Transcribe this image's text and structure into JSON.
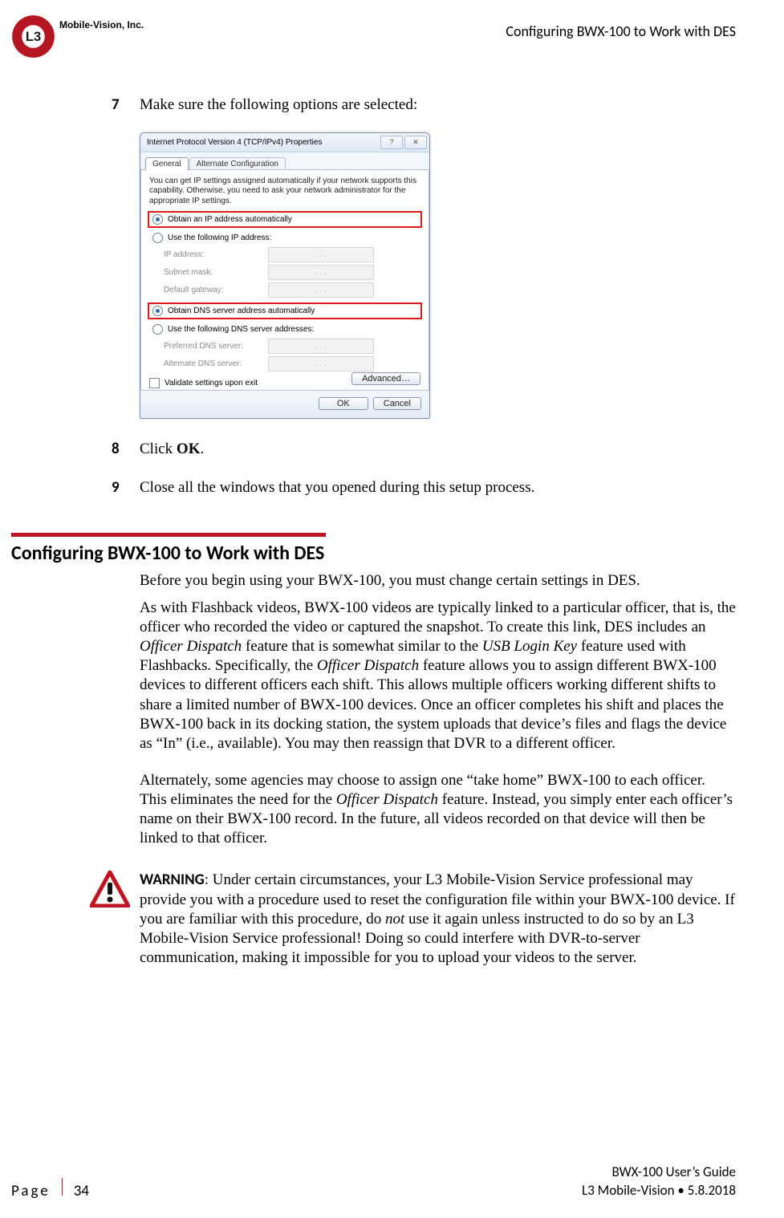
{
  "header": {
    "company": "Mobile-Vision, Inc.",
    "doc_section": "Configuring BWX-100 to Work with DES"
  },
  "steps": {
    "s7": {
      "num": "7",
      "text": "Make sure the following options are selected:"
    },
    "s8": {
      "num": "8",
      "text_pre": "Click ",
      "text_bold": "OK",
      "text_post": "."
    },
    "s9": {
      "num": "9",
      "text": "Close all the windows that you opened during this setup process."
    }
  },
  "dialog": {
    "title": "Internet Protocol Version 4 (TCP/IPv4) Properties",
    "help_glyph": "?",
    "close_glyph": "✕",
    "tabs": {
      "general": "General",
      "alt": "Alternate Configuration"
    },
    "desc": "You can get IP settings assigned automatically if your network supports this capability. Otherwise, you need to ask your network administrator for the appropriate IP settings.",
    "r_obtain_ip": "Obtain an IP address automatically",
    "r_use_ip": "Use the following IP address:",
    "f_ip": "IP address:",
    "f_subnet": "Subnet mask:",
    "f_gateway": "Default gateway:",
    "r_obtain_dns": "Obtain DNS server address automatically",
    "r_use_dns": "Use the following DNS server addresses:",
    "f_dns1": "Preferred DNS server:",
    "f_dns2": "Alternate DNS server:",
    "placeholder": ".       .       .",
    "chk_validate": "Validate settings upon exit",
    "btn_adv": "Advanced…",
    "btn_ok": "OK",
    "btn_cancel": "Cancel"
  },
  "section": {
    "title": "Configuring BWX-100 to Work with DES",
    "p1": "Before you begin using your BWX-100, you must change certain settings in DES.",
    "p2_a": "As with Flashback videos, BWX-100 videos are typically linked to a particular officer, that is, the officer who recorded the video or captured the snapshot. To create this link, DES includes an ",
    "p2_i1": "Officer Dispatch",
    "p2_b": " feature that is somewhat similar to the ",
    "p2_i2": "USB Login Key",
    "p2_c": " feature used with Flashbacks. Specifically, the ",
    "p2_i3": "Officer Dispatch",
    "p2_d": " feature allows you to assign different BWX-100 devices to different officers each shift. This allows multiple officers working different shifts to share a limited number of BWX-100 devices. Once an officer completes his shift and places the BWX-100 back in its docking station, the system uploads that device’s files and flags the device as “In” (i.e., available). You may then reassign that DVR to a different officer.",
    "p3_a": "Alternately, some agencies may choose to assign one “take home” BWX-100 to each officer. This eliminates the need for the ",
    "p3_i1": "Officer Dispatch",
    "p3_b": " feature. Instead, you simply enter each officer’s name on their BWX-100 record. In the future, all videos recorded on that device will then be linked to that officer."
  },
  "warning": {
    "label": "WARNING",
    "t1": ": Under certain circumstances, your L3 Mobile-Vision Service profes­sional may provide you with a procedure used to reset the configuration file within your BWX-100 device. If you are familiar with this procedure, do ",
    "t_not": "not",
    "t2": " use it again unless instructed to do so by an L3 Mobile-Vision Service professional! Doing so could interfere with DVR-to-server communication, making it impossible for you to upload your videos to the server."
  },
  "footer": {
    "page_word": "Page",
    "page_num": "34",
    "guide": "BWX-100 User’s Guide",
    "vendor": "L3 Mobile-Vision • 5.8.2018"
  }
}
